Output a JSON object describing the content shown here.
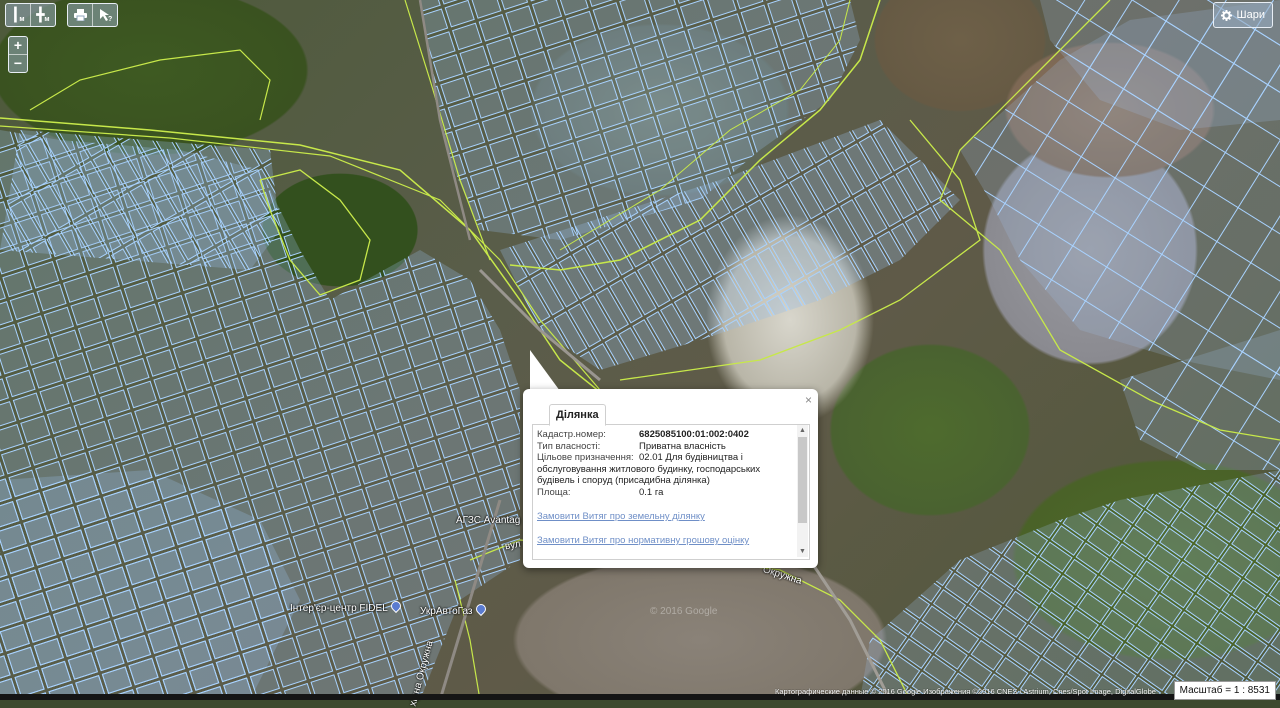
{
  "toolbar": {
    "measure_label": "м",
    "area_label": "м",
    "zoom_in": "+",
    "zoom_out": "−"
  },
  "layers_button": {
    "label": "Шари"
  },
  "map_labels": {
    "interior_center": "Інтер'єр-центр FIDEL",
    "ukr_avto_gaz": "УкрАвтоГаз",
    "azs": "АГЗС Avantag",
    "street_vul": "вул",
    "street_okruzhna": "Окружна",
    "street_vertical": "хідна Окружна",
    "watermark": "© 2016 Google"
  },
  "popup": {
    "tab_label": "Ділянка",
    "close": "×",
    "fields": [
      {
        "key": "Кадастр.номер:",
        "value": "6825085100:01:002:0402"
      },
      {
        "key": "Тип власності:",
        "value": "Приватна власність"
      },
      {
        "key": "Цільове призначення:",
        "value": "02.01 Для будівництва і обслуговування житлового будинку, господарських будівель і споруд (присадибна ділянка)"
      },
      {
        "key": "Площа:",
        "value": "0.1 га"
      }
    ],
    "link_land_extract": "Замовити Витяг про земельну ділянку",
    "link_normative_extract": "Замовити Витяг про нормативну грошову оцінку"
  },
  "attribution": "Картографические данные © 2016 Google Изображения ©2016 CNES / Astrium, Cnes/Spot Image, DigitalGlobe",
  "scale": "Масштаб = 1 : 8531",
  "icons": [
    "ruler-icon",
    "area-ruler-icon",
    "print-icon",
    "identify-cursor-icon",
    "gear-icon",
    "close-icon",
    "map-pin-icon"
  ]
}
